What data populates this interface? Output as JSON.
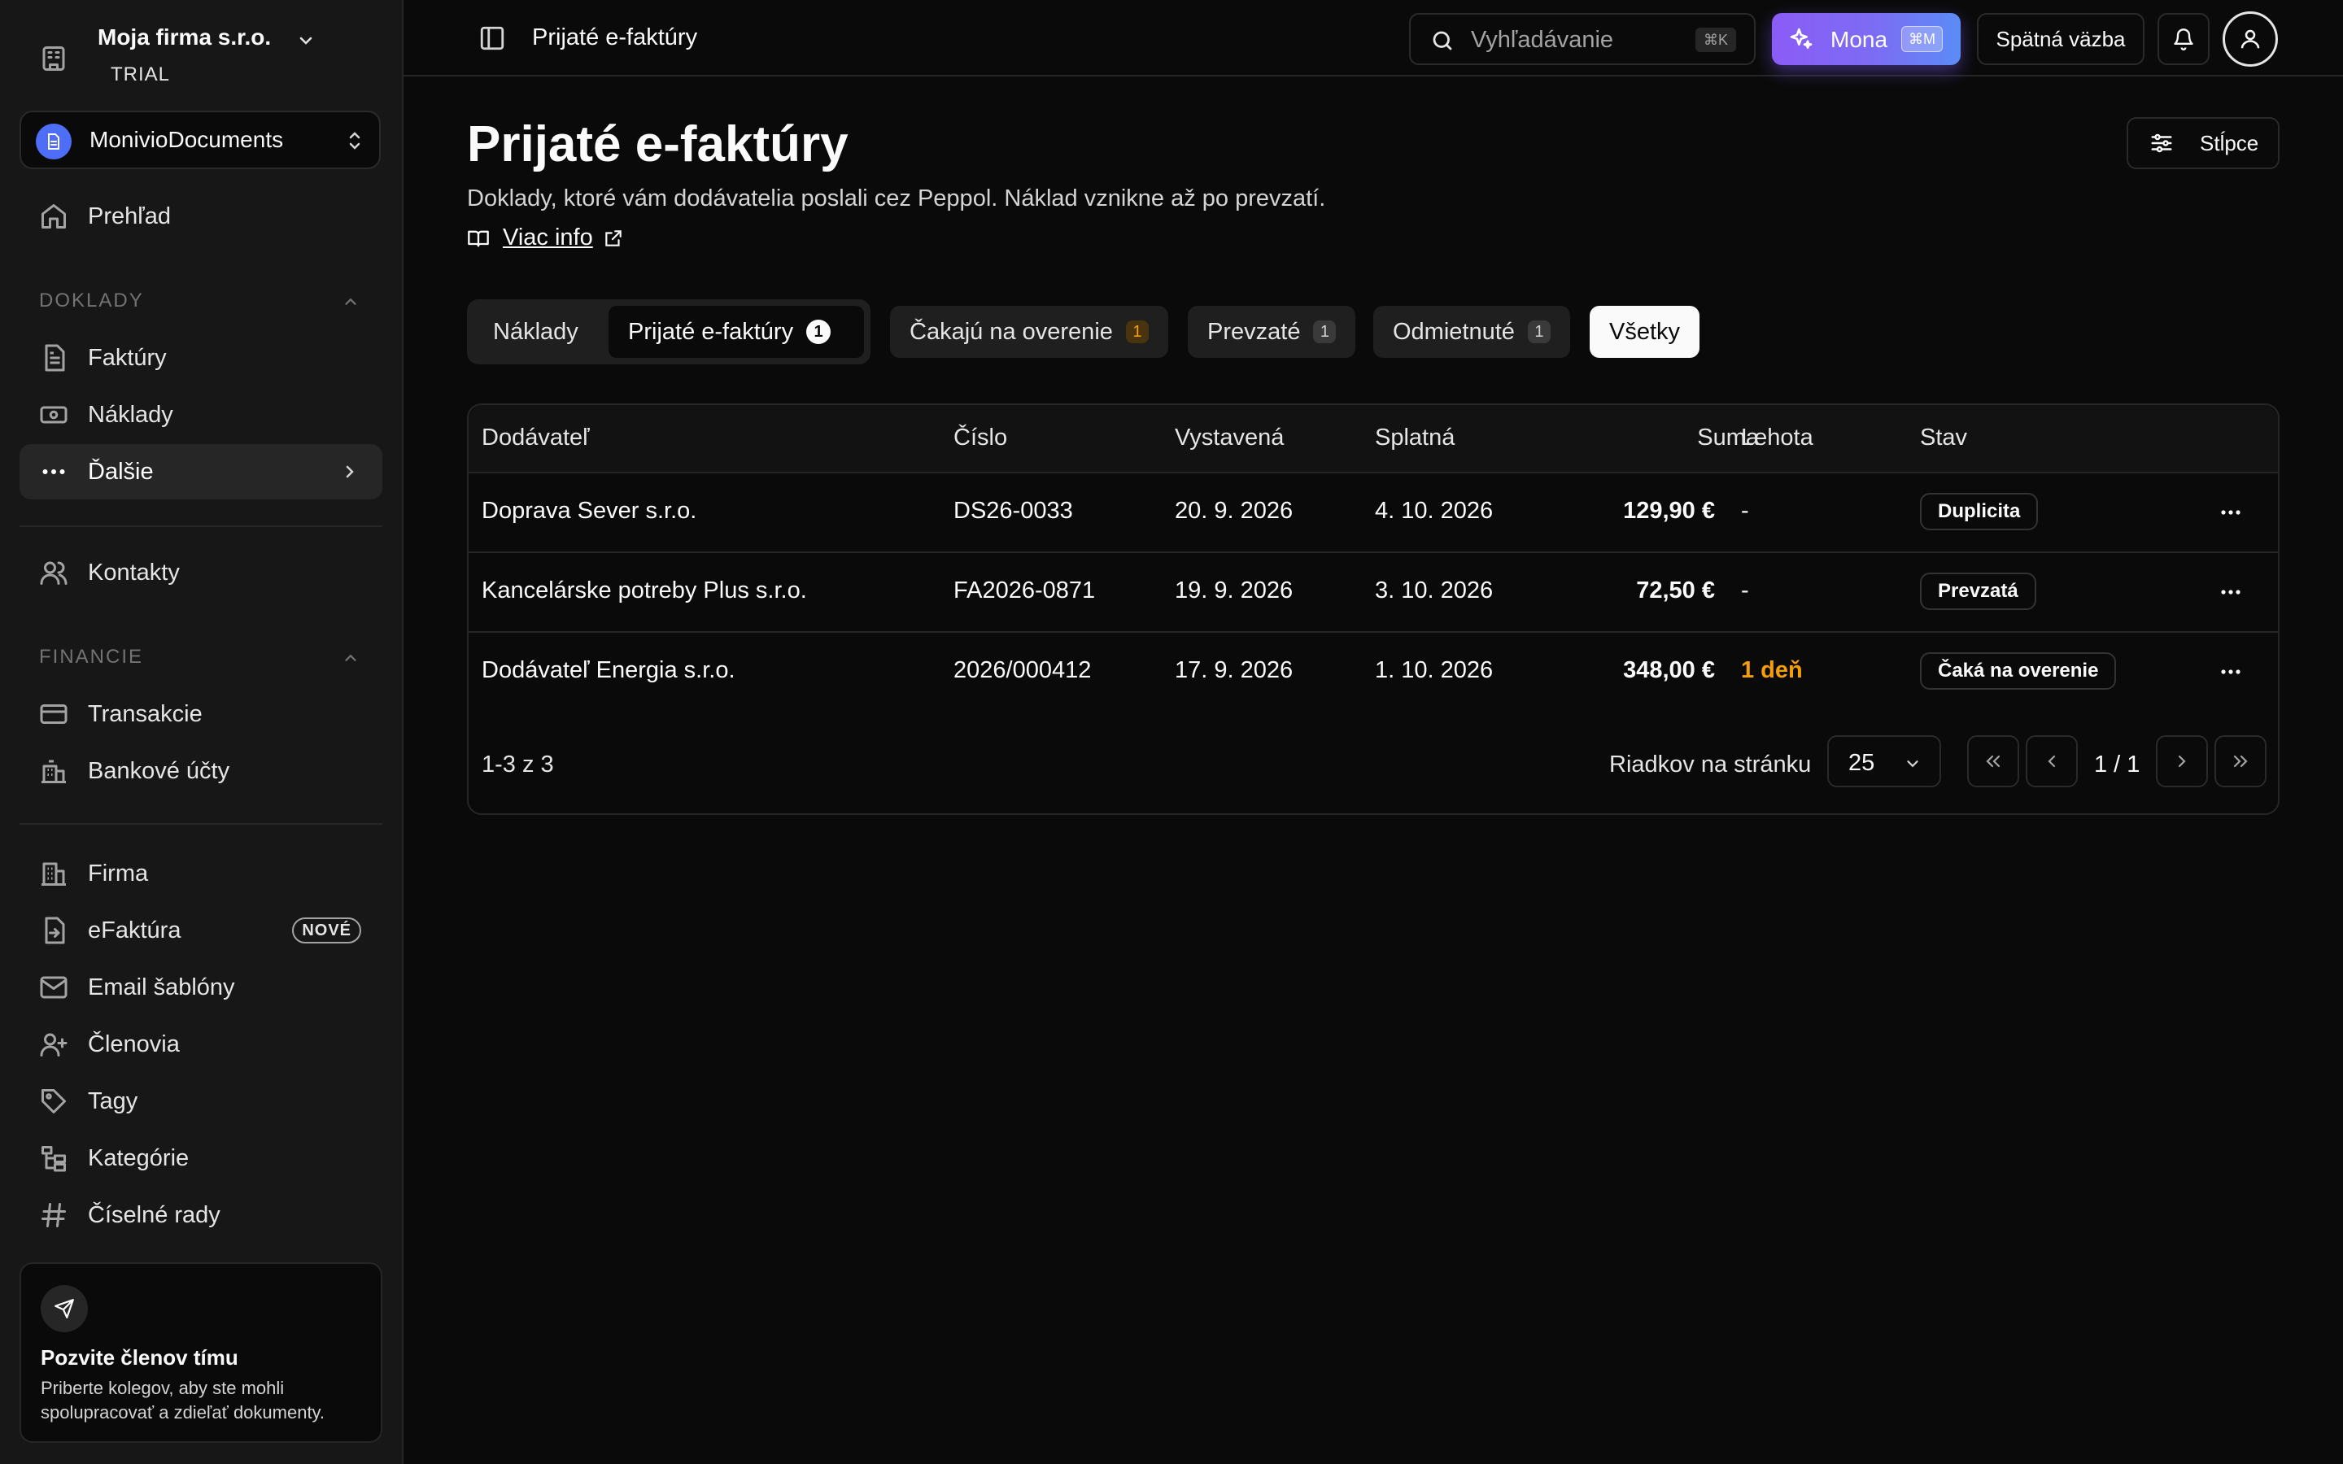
{
  "sidebar": {
    "company": {
      "name": "Moja firma s.r.o.",
      "plan": "TRIAL"
    },
    "app_switcher": {
      "label": "MonivioDocuments"
    },
    "overview": "Prehľad",
    "sections": {
      "doklady": "DOKLADY",
      "financie": "FINANCIE"
    },
    "items": {
      "faktury": "Faktúry",
      "naklady": "Náklady",
      "dalsie": "Ďalšie",
      "kontakty": "Kontakty",
      "transakcie": "Transakcie",
      "bankove_ucty": "Bankové účty",
      "firma": "Firma",
      "efaktura": "eFaktúra",
      "efaktura_badge": "NOVÉ",
      "email_sablony": "Email šablóny",
      "clenovia": "Členovia",
      "tagy": "Tagy",
      "kategorie": "Kategórie",
      "ciselne_rady": "Číselné rady"
    },
    "invite": {
      "title": "Pozvite členov tímu",
      "description": "Priberte kolegov, aby ste mohli spolupracovať a zdieľať dokumenty."
    }
  },
  "topbar": {
    "breadcrumb": "Prijaté e-faktúry",
    "search": {
      "placeholder": "Vyhľadávanie",
      "shortcut": "⌘K"
    },
    "mona": {
      "label": "Mona",
      "shortcut": "⌘M"
    },
    "feedback": "Spätná väzba"
  },
  "page": {
    "title": "Prijaté e-faktúry",
    "description": "Doklady, ktoré vám dodávatelia poslali cez Peppol. Náklad vznikne až po prevzatí.",
    "more_info": "Viac info",
    "columns_button": "Stĺpce"
  },
  "tabs": {
    "naklady": "Náklady",
    "prijate": {
      "label": "Prijaté e-faktúry",
      "count": "1"
    }
  },
  "filters": {
    "cakaju": {
      "label": "Čakajú na overenie",
      "count": "1"
    },
    "prevzate": {
      "label": "Prevzaté",
      "count": "1"
    },
    "odmietnute": {
      "label": "Odmietnuté",
      "count": "1"
    },
    "vsetky": {
      "label": "Všetky"
    }
  },
  "table": {
    "headers": {
      "supplier": "Dodávateľ",
      "number": "Číslo",
      "issued": "Vystavená",
      "due": "Splatná",
      "amount": "Suma",
      "deadline": "Lehota",
      "status": "Stav"
    },
    "rows": [
      {
        "supplier": "Doprava Sever s.r.o.",
        "number": "DS26-0033",
        "issued": "20. 9. 2026",
        "due": "4. 10. 2026",
        "amount": "129,90 €",
        "deadline": "-",
        "status": "Duplicita"
      },
      {
        "supplier": "Kancelárske potreby Plus s.r.o.",
        "number": "FA2026-0871",
        "issued": "19. 9. 2026",
        "due": "3. 10. 2026",
        "amount": "72,50 €",
        "deadline": "-",
        "status": "Prevzatá"
      },
      {
        "supplier": "Dodávateľ Energia s.r.o.",
        "number": "2026/000412",
        "issued": "17. 9. 2026",
        "due": "1. 10. 2026",
        "amount": "348,00 €",
        "deadline": "1 deň",
        "status": "Čaká na overenie"
      }
    ],
    "footer": {
      "range": "1-3 z 3",
      "rows_per_page_label": "Riadkov na stránku",
      "rows_per_page": "25",
      "page_info": "1 / 1"
    }
  },
  "colors": {
    "accent_warning": "#f59e0b",
    "mona_gradient_start": "#8b5cf6",
    "mona_gradient_end": "#5b8cf6",
    "app_icon": "#4f6ef7"
  }
}
